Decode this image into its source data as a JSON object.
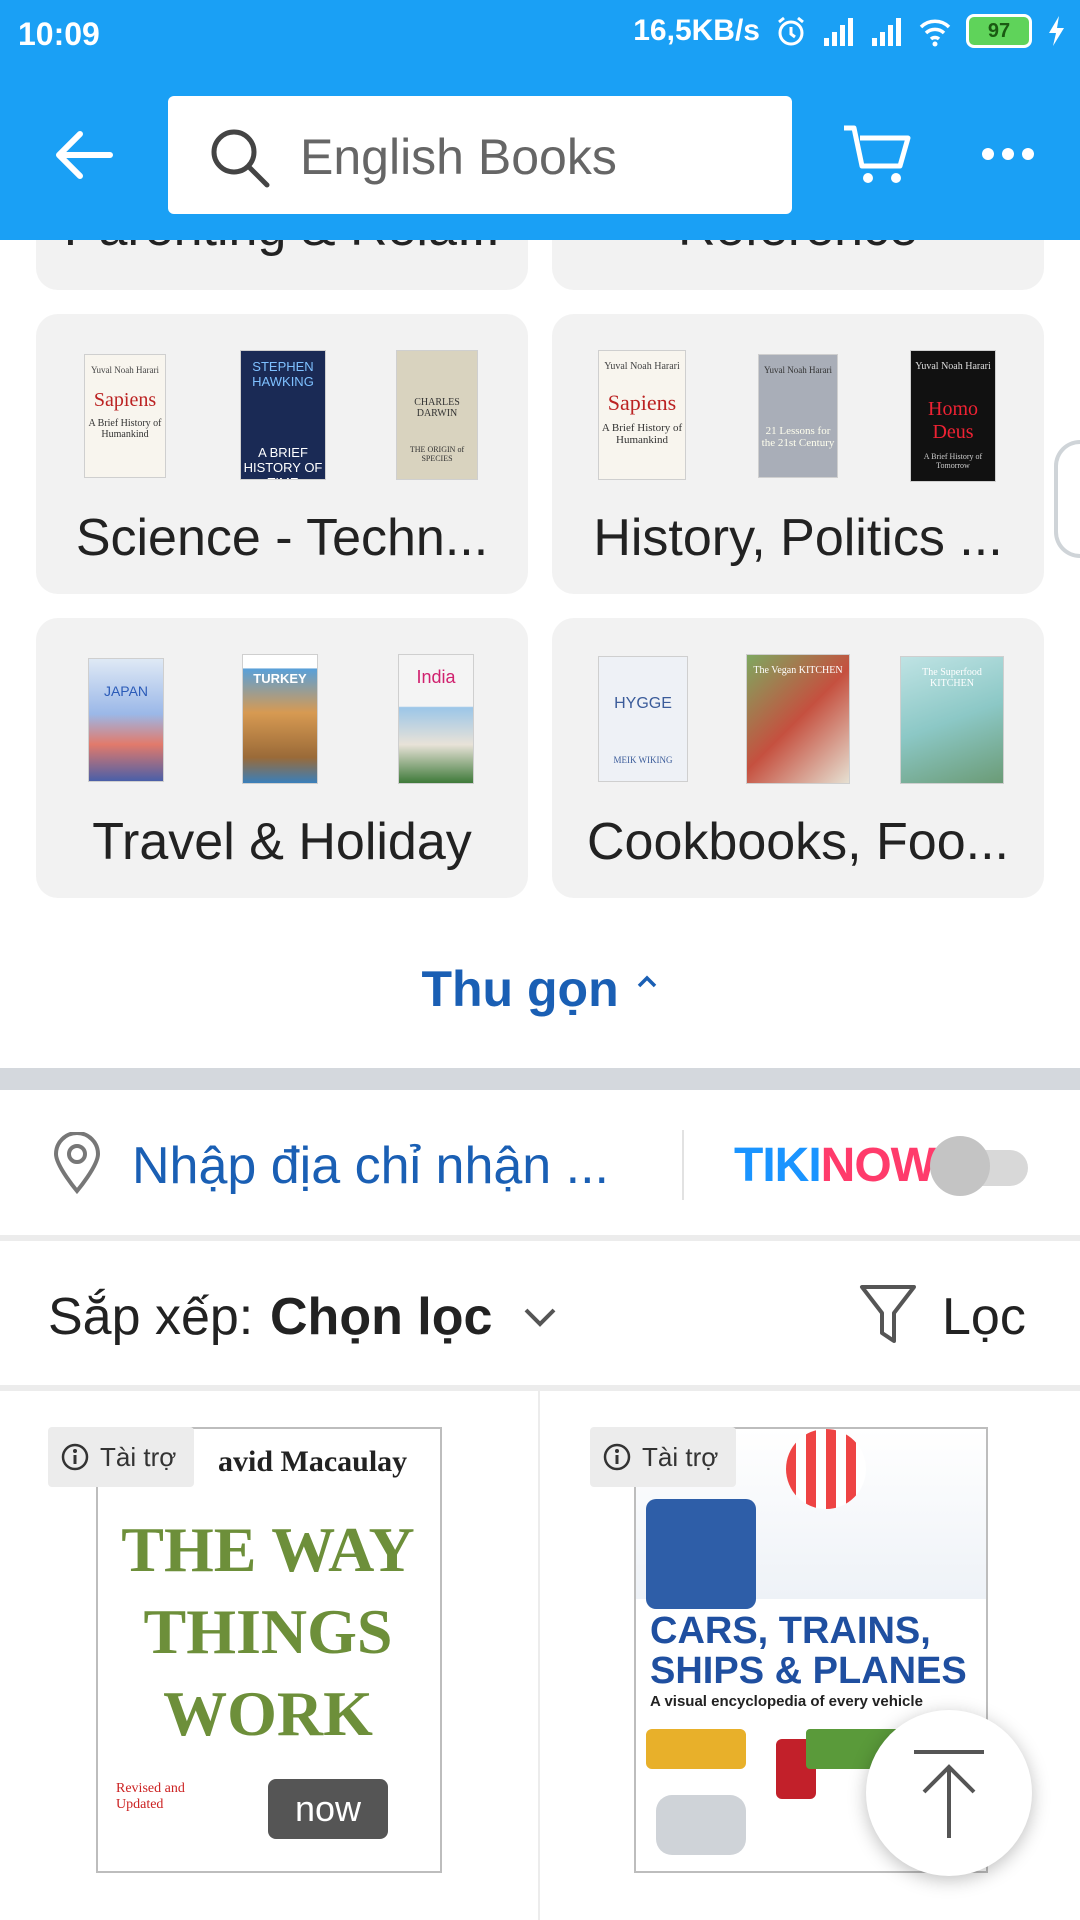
{
  "status_bar": {
    "time": "10:09",
    "network_speed": "16,5KB/s",
    "battery": "97"
  },
  "header": {
    "search_text": "English Books"
  },
  "categories": [
    {
      "label": "Parenting & Rela..."
    },
    {
      "label": "Reference"
    },
    {
      "label": "Science - Techn..."
    },
    {
      "label": "History, Politics ..."
    },
    {
      "label": "Travel & Holiday"
    },
    {
      "label": "Cookbooks, Foo..."
    }
  ],
  "books": {
    "sapiens": {
      "author": "Yuval Noah Harari",
      "title": "Sapiens",
      "sub": "A Brief History of Humankind"
    },
    "hawking": {
      "author": "STEPHEN HAWKING",
      "title": "A BRIEF HISTORY OF TIME"
    },
    "darwin": {
      "author": "CHARLES DARWIN",
      "title": "THE ORIGIN of SPECIES"
    },
    "lessons": {
      "author": "Yuval Noah Harari",
      "title": "21 Lessons for the 21st Century"
    },
    "homodeus": {
      "author": "Yuval Noah Harari",
      "title": "Homo Deus",
      "sub": "A Brief History of Tomorrow"
    },
    "japan": {
      "title": "JAPAN"
    },
    "turkey": {
      "title": "TURKEY"
    },
    "india": {
      "title": "India"
    },
    "hygge": {
      "title": "HYGGE",
      "author": "MEIK WIKING"
    },
    "vegan": {
      "title": "The Vegan KITCHEN"
    },
    "superfood": {
      "title": "The Superfood KITCHEN"
    }
  },
  "collapse_label": "Thu gọn",
  "address": {
    "placeholder": "Nhập địa chỉ nhận ...",
    "tikinow_part1": "TIKI",
    "tikinow_part2": "NOW"
  },
  "sort": {
    "label": "Sắp xếp:",
    "value": "Chọn lọc",
    "filter_label": "Lọc"
  },
  "products": [
    {
      "sponsor_label": "Tài trợ",
      "author_text": "avid Macaulay",
      "title_text": "THE WAY THINGS WORK",
      "badge": "Revised and Updated",
      "now": "now"
    },
    {
      "sponsor_label": "Tài trợ",
      "title_text": "CARS, TRAINS, SHIPS & PLANES",
      "subtitle": "A visual encyclopedia of every vehicle"
    }
  ],
  "colors": {
    "brand_blue": "#1aa0f5",
    "link_blue": "#1a5fb4",
    "tiki_blue": "#1a94ff",
    "tiki_pink": "#ff3b6b"
  }
}
